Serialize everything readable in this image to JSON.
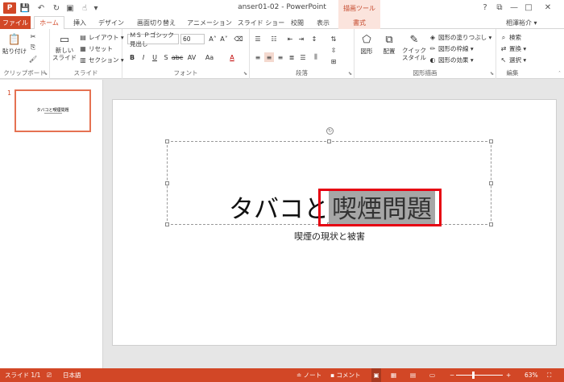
{
  "titlebar": {
    "title": "anser01-02 - PowerPoint",
    "logo_text": "P",
    "contextual_label": "描画ツール",
    "help": "?",
    "restore": "⧉",
    "minimize": "—",
    "maximize": "□",
    "close": "✕"
  },
  "tabs": {
    "file": "ファイル",
    "home": "ホーム",
    "insert": "挿入",
    "design": "デザイン",
    "transitions": "画面切り替え",
    "animations": "アニメーション",
    "slideshow": "スライド ショー",
    "review": "校閲",
    "view": "表示",
    "format": "書式",
    "user": "相澤裕介 ▾"
  },
  "ribbon": {
    "clipboard": {
      "paste": "貼り付け",
      "label": "クリップボード"
    },
    "slides": {
      "new_slide": "新しい\nスライド",
      "layout": "レイアウト ▾",
      "reset": "リセット",
      "section": "セクション ▾",
      "label": "スライド"
    },
    "font": {
      "font_name": "ＭＳ Ｐゴシック 見出し",
      "font_size": "60",
      "label": "フォント"
    },
    "paragraph": {
      "label": "段落"
    },
    "drawing": {
      "shapes": "図形",
      "arrange": "配置",
      "quick_styles": "クイック\nスタイル",
      "fill": "図形の塗りつぶし ▾",
      "outline": "図形の枠線 ▾",
      "effects": "図形の効果 ▾",
      "label": "図形描画"
    },
    "editing": {
      "find": "検索",
      "replace": "置換 ▾",
      "select": "選択 ▾",
      "label": "編集"
    }
  },
  "thumbnail": {
    "number": "1",
    "title": "タバコと喫煙問題"
  },
  "slide": {
    "title_plain": "タバコと",
    "title_selected": "喫煙問題",
    "subtitle": "喫煙の現状と被害"
  },
  "status": {
    "slide_count": "スライド 1/1",
    "language": "日本語",
    "notes": "ノート",
    "comments": "コメント",
    "zoom": "63%"
  },
  "colors": {
    "accent": "#d24726",
    "highlight_box": "#e60012",
    "selection": "#a6a6a6"
  }
}
